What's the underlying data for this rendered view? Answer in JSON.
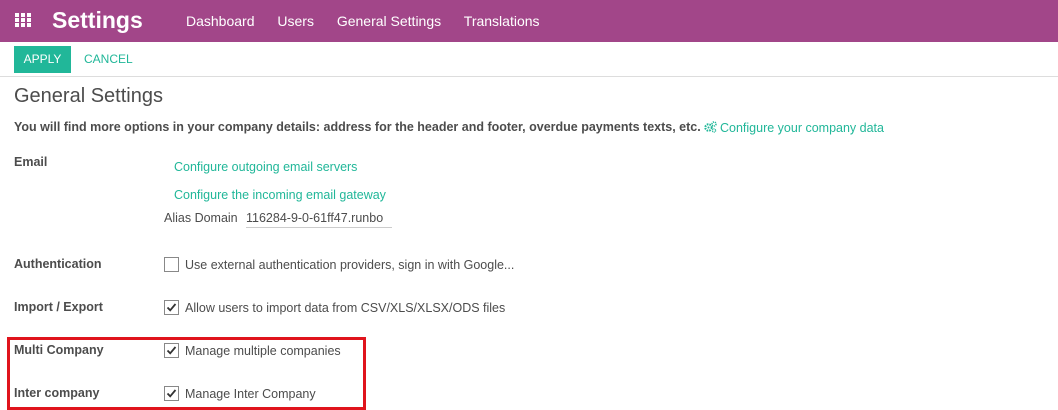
{
  "topbar": {
    "app_title": "Settings",
    "nav": [
      "Dashboard",
      "Users",
      "General Settings",
      "Translations"
    ]
  },
  "controls": {
    "apply": "APPLY",
    "cancel": "CANCEL"
  },
  "page": {
    "title": "General Settings",
    "intro": "You will find more options in your company details: address for the header and footer, overdue payments texts, etc.",
    "company_link": "Configure your company data"
  },
  "email": {
    "label": "Email",
    "outgoing_link": "Configure outgoing email servers",
    "incoming_link": "Configure the incoming email gateway",
    "alias_label": "Alias Domain",
    "alias_value": "116284-9-0-61ff47.runbo"
  },
  "settings": [
    {
      "label": "Authentication",
      "text": "Use external authentication providers, sign in with Google...",
      "checked": false
    },
    {
      "label": "Import / Export",
      "text": "Allow users to import data from CSV/XLS/XLSX/ODS files",
      "checked": true
    },
    {
      "label": "Multi Company",
      "text": "Manage multiple companies",
      "checked": true
    },
    {
      "label": "Inter company",
      "text": "Manage Inter Company",
      "checked": true
    }
  ],
  "colors": {
    "brand": "#a24689",
    "accent": "#21b799",
    "highlight": "#e0141d"
  }
}
